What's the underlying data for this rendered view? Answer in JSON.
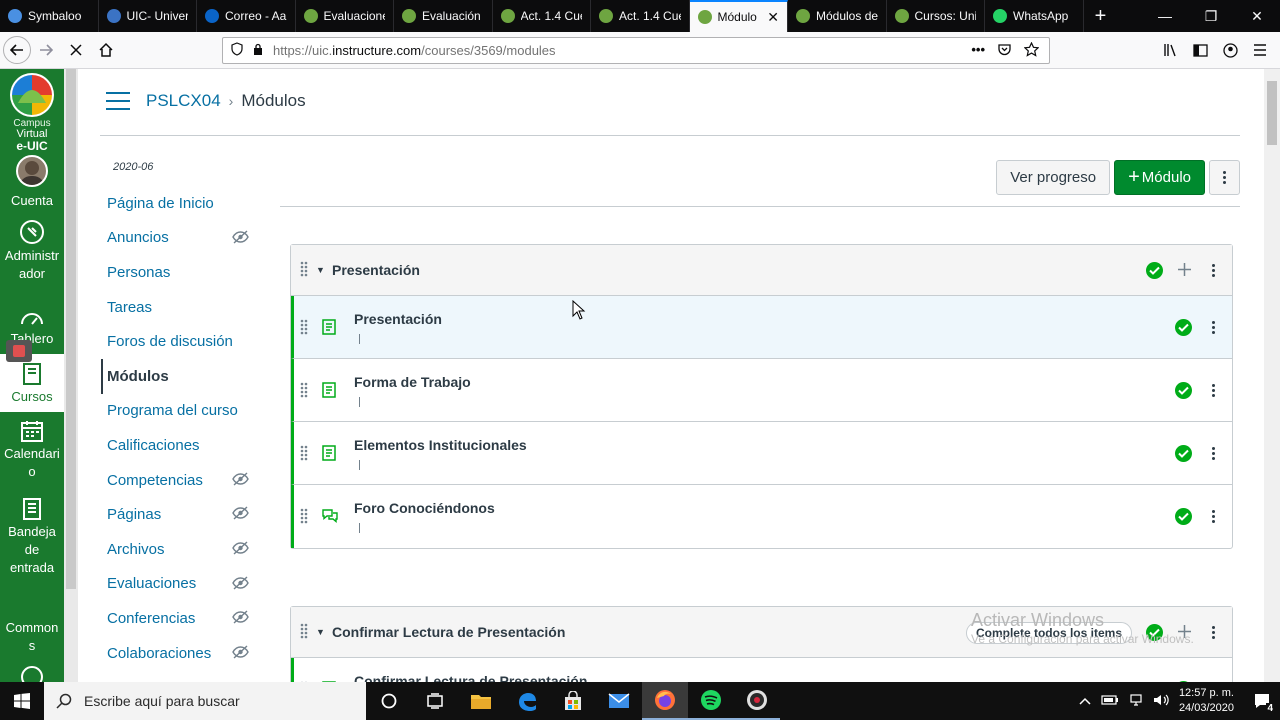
{
  "browser": {
    "tabs": [
      {
        "label": "Symbaloo",
        "color": "#4a90e2"
      },
      {
        "label": "UIC- Univer",
        "color": "#3b73c4"
      },
      {
        "label": "Correo - Aa",
        "color": "#0a64c8"
      },
      {
        "label": "Evaluacione",
        "color": "#6ea541"
      },
      {
        "label": "Evaluación",
        "color": "#6ea541"
      },
      {
        "label": "Act. 1.4 Cue",
        "color": "#6ea541"
      },
      {
        "label": "Act. 1.4 Cue",
        "color": "#6ea541"
      },
      {
        "label": "Módulo",
        "color": "#6ea541",
        "active": true
      },
      {
        "label": "Módulos de",
        "color": "#6ea541"
      },
      {
        "label": "Cursos: Uni",
        "color": "#6ea541"
      },
      {
        "label": "WhatsApp",
        "color": "#25d366"
      }
    ],
    "url_prefix": "https://uic.",
    "url_host": "instructure.com",
    "url_path": "/courses/3569/modules"
  },
  "globalnav": {
    "logo_line1": "Campus",
    "logo_line2": "Virtual",
    "logo_line3": "e-UIC",
    "items": [
      {
        "label": "Cuenta"
      },
      {
        "label": "Administrador"
      },
      {
        "label": "Tablero"
      },
      {
        "label": "Cursos"
      },
      {
        "label": "Calendario"
      },
      {
        "label": "Bandeja de entrada"
      },
      {
        "label": "Commons"
      }
    ]
  },
  "breadcrumb": {
    "course": "PSLCX04",
    "separator": "›",
    "page": "Módulos"
  },
  "term": "2020-06",
  "coursenav": [
    {
      "label": "Página de Inicio",
      "hidden": false
    },
    {
      "label": "Anuncios",
      "hidden": true
    },
    {
      "label": "Personas",
      "hidden": false
    },
    {
      "label": "Tareas",
      "hidden": false
    },
    {
      "label": "Foros de discusión",
      "hidden": false
    },
    {
      "label": "Módulos",
      "hidden": false,
      "active": true
    },
    {
      "label": "Programa del curso",
      "hidden": false
    },
    {
      "label": "Calificaciones",
      "hidden": false
    },
    {
      "label": "Competencias",
      "hidden": true
    },
    {
      "label": "Páginas",
      "hidden": true
    },
    {
      "label": "Archivos",
      "hidden": true
    },
    {
      "label": "Evaluaciones",
      "hidden": true
    },
    {
      "label": "Conferencias",
      "hidden": true
    },
    {
      "label": "Colaboraciones",
      "hidden": true
    }
  ],
  "toolbar": {
    "progress_label": "Ver progreso",
    "module_label": "Módulo",
    "plus": "+"
  },
  "modules": [
    {
      "title": "Presentación",
      "items": [
        {
          "title": "Presentación",
          "type": "page",
          "highlight": true
        },
        {
          "title": "Forma de Trabajo",
          "type": "page"
        },
        {
          "title": "Elementos Institucionales",
          "type": "page"
        },
        {
          "title": "Foro Conociéndonos",
          "type": "discussion"
        }
      ]
    },
    {
      "title": "Confirmar Lectura de Presentación",
      "requirement": "Complete todos los items",
      "items": [
        {
          "title": "Confirmar Lectura de Presentación",
          "type": "page"
        }
      ]
    }
  ],
  "watermark": {
    "line1": "Activar Windows",
    "line2": "Ve a Configuración para activar Windows."
  },
  "taskbar": {
    "search_placeholder": "Escribe aquí para buscar",
    "time": "12:57 p. m.",
    "date": "24/03/2020",
    "notifications": "4"
  },
  "colors": {
    "canvas_green": "#1a7a2e",
    "link_blue": "#0770a3",
    "success_green": "#00ac18"
  }
}
